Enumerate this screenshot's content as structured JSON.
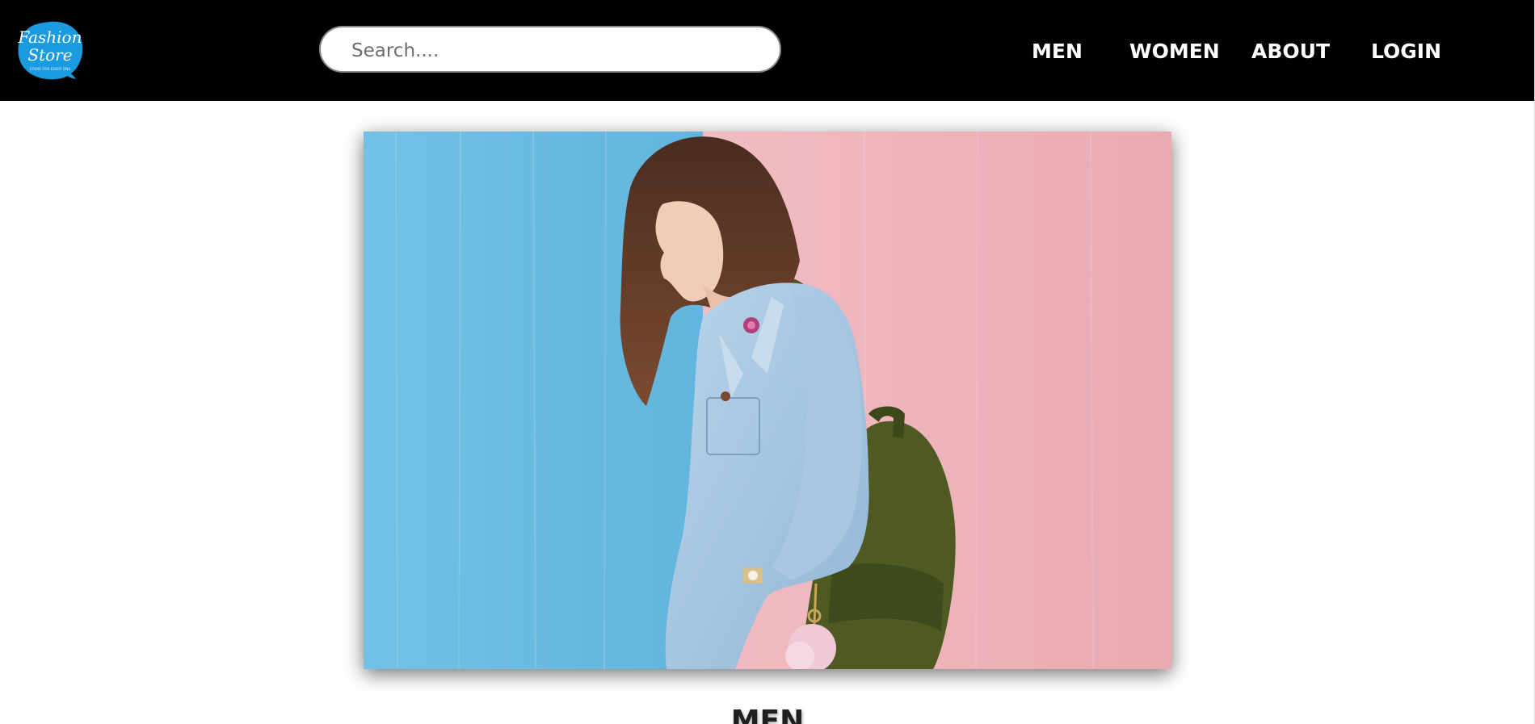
{
  "header": {
    "logo": {
      "line1": "Fashion",
      "line2": "Store",
      "tagline": "STORE FOR EVERY ONE",
      "badge_color": "#1a9be0"
    },
    "search": {
      "placeholder": "Search....",
      "value": ""
    },
    "nav": {
      "men": "MEN",
      "women": "WOMEN",
      "about": "ABOUT",
      "login": "LOGIN"
    },
    "background_color": "#000000"
  },
  "hero": {
    "image_description_icon": "hero-photo-icon",
    "left_wall_color": "#6cbde3",
    "right_wall_color": "#efb4bc"
  },
  "main": {
    "section_title": "MEN"
  }
}
